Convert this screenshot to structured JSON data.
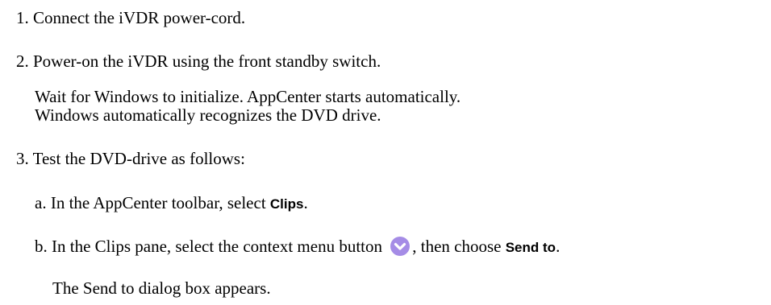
{
  "steps": [
    {
      "number": "1.",
      "text": "Connect the iVDR power-cord."
    },
    {
      "number": "2.",
      "text": "Power-on the iVDR using the front standby switch.",
      "notes": [
        "Wait for Windows to initialize. AppCenter starts automatically.",
        "Windows automatically recognizes the DVD drive."
      ]
    },
    {
      "number": "3.",
      "text": "Test the DVD-drive as follows:",
      "substeps": [
        {
          "letter": "a.",
          "text_before": "In the AppCenter toolbar, select ",
          "ui_term": "Clips",
          "text_after": "."
        },
        {
          "letter": "b.",
          "text_before": "In the Clips pane, select the context menu button ",
          "icon": "context-menu-chevron-down-icon",
          "text_middle": ", then choose ",
          "ui_term": "Send to",
          "text_after": ".",
          "result": "The Send to dialog box appears."
        }
      ]
    }
  ],
  "colors": {
    "text": "#000000",
    "context_icon_fill": "#a58ce6",
    "context_icon_chevron": "#ffffff"
  }
}
